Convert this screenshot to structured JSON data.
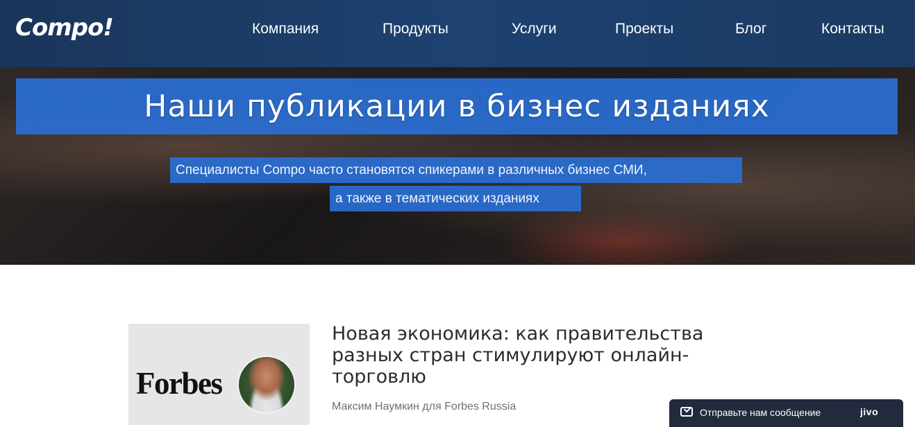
{
  "header": {
    "logo": "Compo!",
    "nav": [
      "Компания",
      "Продукты",
      "Услуги",
      "Проекты",
      "Блог",
      "Контакты"
    ]
  },
  "hero": {
    "title": "Наши публикации в бизнес изданиях",
    "subtitle_line1": "Специалисты Compo часто становятся спикерами в различных бизнес СМИ,",
    "subtitle_line2": "а также в тематических изданиях"
  },
  "article": {
    "thumbnail_publication": "Forbes",
    "title": "Новая экономика: как правительства разных стран стимулируют онлайн-торговлю",
    "author": "Максим Наумкин для Forbes Russia"
  },
  "chat": {
    "label": "Отправьте нам сообщение",
    "brand": "jivo"
  },
  "colors": {
    "header_bg": "#1d4270",
    "accent_band": "#2970d7",
    "chat_bg": "#232a3d"
  }
}
